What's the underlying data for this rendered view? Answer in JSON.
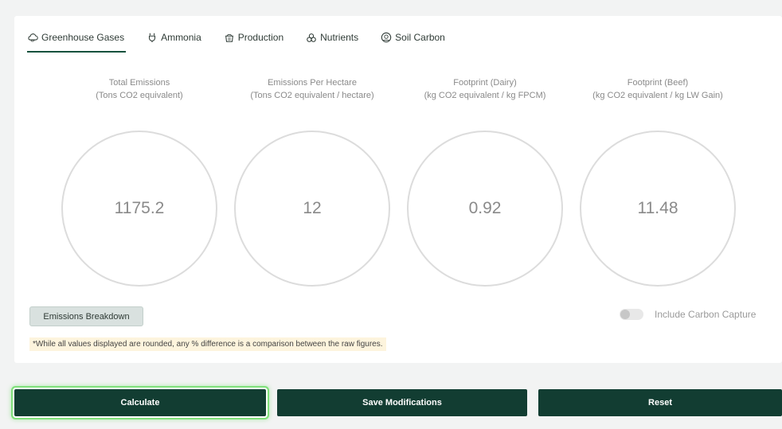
{
  "tabs": [
    {
      "label": "Greenhouse Gases",
      "icon": "cloud-icon",
      "active": true
    },
    {
      "label": "Ammonia",
      "icon": "flask-icon",
      "active": false
    },
    {
      "label": "Production",
      "icon": "basket-icon",
      "active": false
    },
    {
      "label": "Nutrients",
      "icon": "nutrients-icon",
      "active": false
    },
    {
      "label": "Soil Carbon",
      "icon": "soil-carbon-icon",
      "active": false
    }
  ],
  "metrics": [
    {
      "title": "Total Emissions",
      "unit": "(Tons CO2 equivalent)",
      "value": "1175.2"
    },
    {
      "title": "Emissions Per Hectare",
      "unit": "(Tons CO2 equivalent / hectare)",
      "value": "12"
    },
    {
      "title": "Footprint (Dairy)",
      "unit": "(kg CO2 equivalent / kg FPCM)",
      "value": "0.92"
    },
    {
      "title": "Footprint (Beef)",
      "unit": "(kg CO2 equivalent / kg LW Gain)",
      "value": "11.48"
    }
  ],
  "breakdown_button": "Emissions Breakdown",
  "carbon_capture": {
    "label": "Include Carbon Capture",
    "enabled": false
  },
  "note": "*While all values displayed are rounded, any % difference is a comparison between the raw figures.",
  "actions": {
    "calculate": "Calculate",
    "save": "Save Modifications",
    "reset": "Reset"
  },
  "colors": {
    "primary": "#123d32",
    "focus_glow": "#7fe07a",
    "note_bg": "#fdf4dd"
  }
}
